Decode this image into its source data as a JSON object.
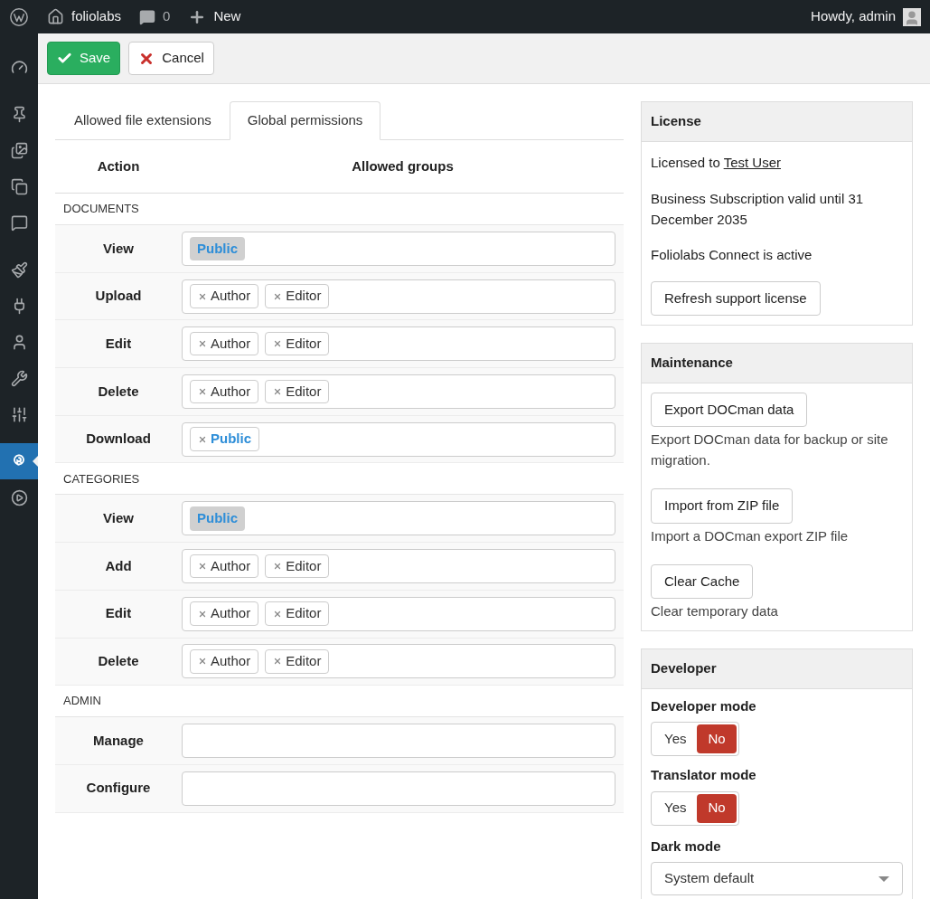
{
  "admin_bar": {
    "site": "foliolabs",
    "comments": "0",
    "new": "New",
    "greeting": "Howdy, admin"
  },
  "sidebar": {
    "items": [
      {
        "kind": "dashboard",
        "selected": false
      },
      {
        "kind": "posts",
        "selected": false
      },
      {
        "kind": "media",
        "selected": false
      },
      {
        "kind": "pages",
        "selected": false
      },
      {
        "kind": "comments",
        "selected": false
      },
      {
        "kind": "appearance",
        "selected": false
      },
      {
        "kind": "plugins",
        "selected": false
      },
      {
        "kind": "users",
        "selected": false
      },
      {
        "kind": "tools",
        "selected": false
      },
      {
        "kind": "settings",
        "selected": false
      },
      {
        "kind": "docman",
        "selected": true
      },
      {
        "kind": "collapse",
        "selected": false
      }
    ]
  },
  "toolbar": {
    "save": "Save",
    "cancel": "Cancel"
  },
  "tabs": [
    {
      "label": "Allowed file extensions",
      "selected": false
    },
    {
      "label": "Global permissions",
      "selected": true
    }
  ],
  "permissions": {
    "columns": [
      "Action",
      "Allowed groups"
    ],
    "sections": [
      {
        "title": "DOCUMENTS",
        "rows": [
          {
            "action": "View",
            "tags": [
              {
                "label": "Public",
                "kind": "locked",
                "emphasized": true
              }
            ]
          },
          {
            "action": "Upload",
            "tags": [
              {
                "label": "Author",
                "kind": "removable",
                "emphasized": false
              },
              {
                "label": "Editor",
                "kind": "removable",
                "emphasized": false
              }
            ]
          },
          {
            "action": "Edit",
            "tags": [
              {
                "label": "Author",
                "kind": "removable",
                "emphasized": false
              },
              {
                "label": "Editor",
                "kind": "removable",
                "emphasized": false
              }
            ]
          },
          {
            "action": "Delete",
            "tags": [
              {
                "label": "Author",
                "kind": "removable",
                "emphasized": false
              },
              {
                "label": "Editor",
                "kind": "removable",
                "emphasized": false
              }
            ]
          },
          {
            "action": "Download",
            "tags": [
              {
                "label": "Public",
                "kind": "removable",
                "emphasized": true
              }
            ]
          }
        ]
      },
      {
        "title": "CATEGORIES",
        "rows": [
          {
            "action": "View",
            "tags": [
              {
                "label": "Public",
                "kind": "locked",
                "emphasized": true
              }
            ]
          },
          {
            "action": "Add",
            "tags": [
              {
                "label": "Author",
                "kind": "removable",
                "emphasized": false
              },
              {
                "label": "Editor",
                "kind": "removable",
                "emphasized": false
              }
            ]
          },
          {
            "action": "Edit",
            "tags": [
              {
                "label": "Author",
                "kind": "removable",
                "emphasized": false
              },
              {
                "label": "Editor",
                "kind": "removable",
                "emphasized": false
              }
            ]
          },
          {
            "action": "Delete",
            "tags": [
              {
                "label": "Author",
                "kind": "removable",
                "emphasized": false
              },
              {
                "label": "Editor",
                "kind": "removable",
                "emphasized": false
              }
            ]
          }
        ]
      },
      {
        "title": "ADMIN",
        "rows": [
          {
            "action": "Manage",
            "tags": []
          },
          {
            "action": "Configure",
            "tags": []
          }
        ]
      }
    ]
  },
  "license": {
    "title": "License",
    "licensed_to": "Licensed to",
    "user": "Test User",
    "subscription": "Business Subscription valid until 31 December 2035",
    "connect": "Foliolabs Connect is active",
    "button": "Refresh support license"
  },
  "maintenance": {
    "title": "Maintenance",
    "actions": [
      {
        "button": "Export DOCman data",
        "description": "Export DOCman data for backup or site migration."
      },
      {
        "button": "Import from ZIP file",
        "description": "Import a DOCman export ZIP file"
      },
      {
        "button": "Clear Cache",
        "description": "Clear temporary data"
      }
    ]
  },
  "developer": {
    "title": "Developer",
    "toggles": [
      {
        "label": "Developer mode",
        "options": [
          {
            "label": "Yes",
            "selected": false
          },
          {
            "label": "No",
            "selected": true
          }
        ]
      },
      {
        "label": "Translator mode",
        "options": [
          {
            "label": "Yes",
            "selected": false
          },
          {
            "label": "No",
            "selected": true
          }
        ]
      }
    ],
    "dark_mode": {
      "label": "Dark mode",
      "value": "System default"
    }
  }
}
